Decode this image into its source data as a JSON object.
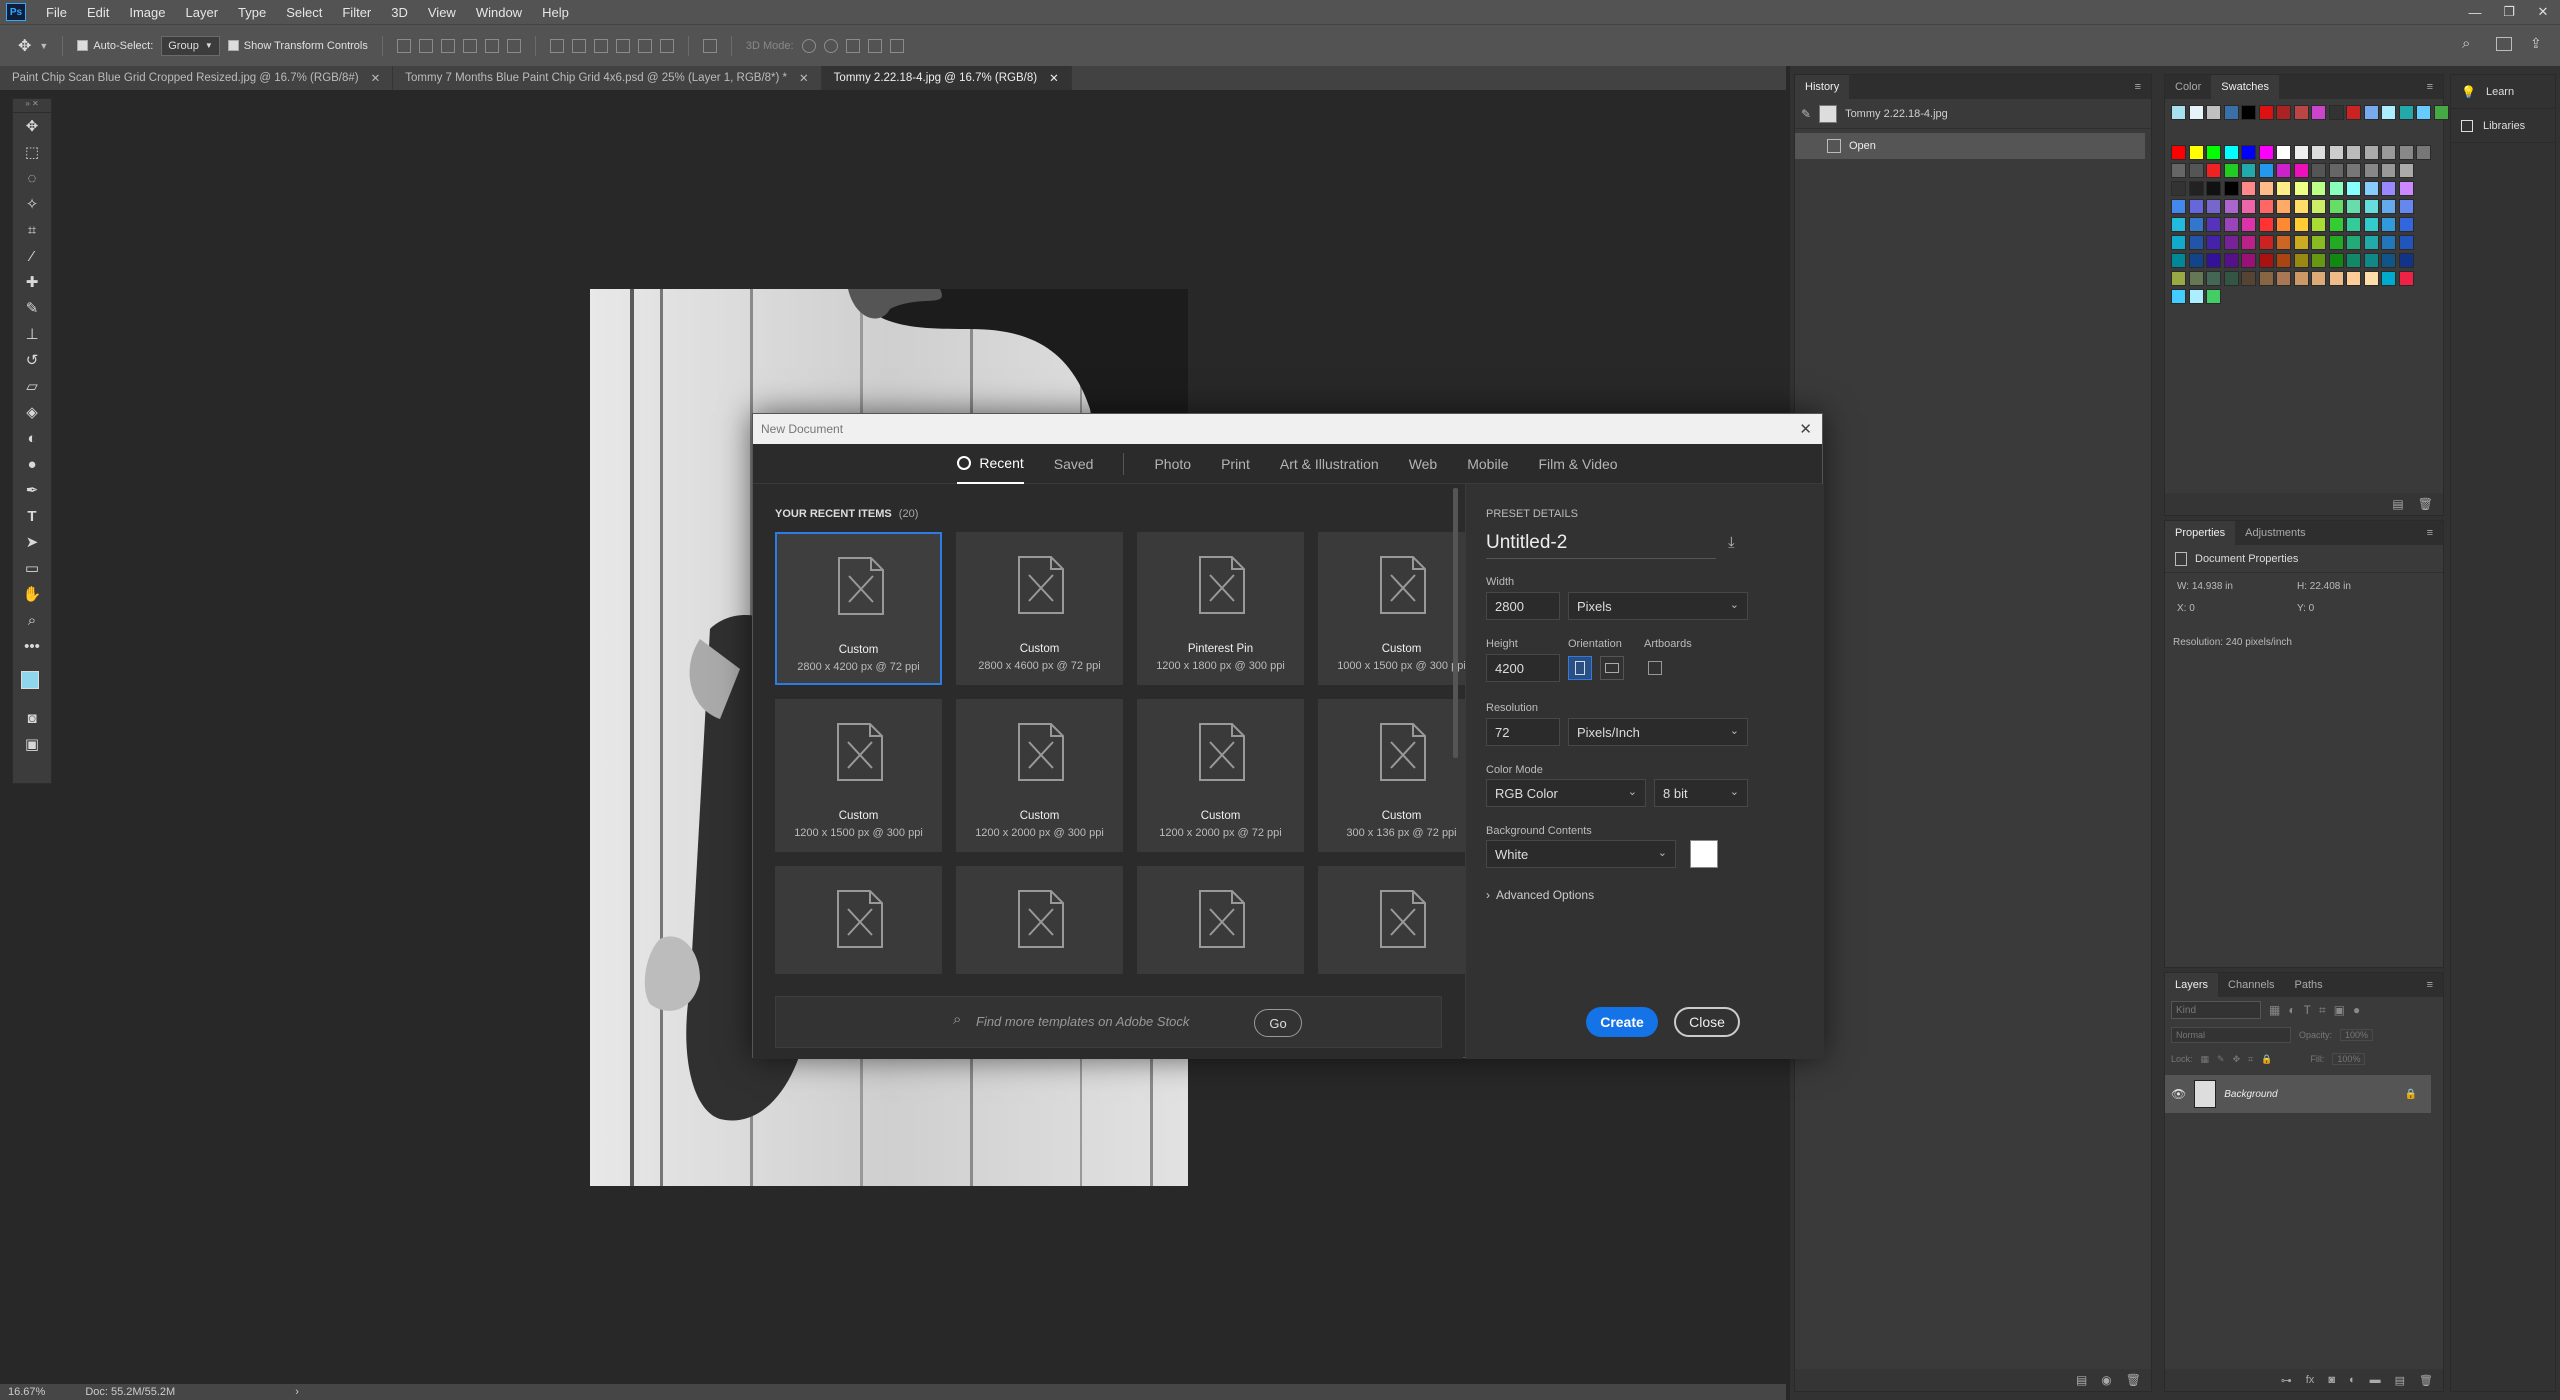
{
  "app": {
    "logo_text": "Ps"
  },
  "menu": [
    "File",
    "Edit",
    "Image",
    "Layer",
    "Type",
    "Select",
    "Filter",
    "3D",
    "View",
    "Window",
    "Help"
  ],
  "window_controls": [
    "—",
    "❐",
    "✕"
  ],
  "options_bar": {
    "auto_select_label": "Auto-Select:",
    "auto_select_value": "Group",
    "show_transform_label": "Show Transform Controls",
    "mode_3d_label": "3D Mode:"
  },
  "doc_tabs": [
    {
      "title": "Paint Chip Scan Blue Grid Cropped Resized.jpg @ 16.7% (RGB/8#)",
      "active": false
    },
    {
      "title": "Tommy 7 Months Blue Paint Chip Grid 4x6.psd @ 25% (Layer 1, RGB/8*) *",
      "active": false
    },
    {
      "title": "Tommy 2.22.18-4.jpg @ 16.7% (RGB/8)",
      "active": true
    }
  ],
  "status": {
    "zoom": "16.67%",
    "doc": "Doc: 55.2M/55.2M"
  },
  "history": {
    "tab": "History",
    "snapshot": "Tommy 2.22.18-4.jpg",
    "items": [
      "Open"
    ]
  },
  "color_panel": {
    "tabs": [
      "Color",
      "Swatches"
    ],
    "active": "Swatches"
  },
  "learn_panel": {
    "learn": "Learn",
    "libraries": "Libraries"
  },
  "properties": {
    "tabs": [
      "Properties",
      "Adjustments"
    ],
    "section": "Document Properties",
    "w": "W:  14.938 in",
    "h": "H:  22.408 in",
    "x": "X:  0",
    "y": "Y:  0",
    "resolution": "Resolution:  240 pixels/inch"
  },
  "layers": {
    "tabs": [
      "Layers",
      "Channels",
      "Paths"
    ],
    "kind_placeholder": "Kind",
    "blend": "Normal",
    "opacity_label": "Opacity:",
    "opacity": "100%",
    "lock_label": "Lock:",
    "fill_label": "Fill:",
    "fill": "100%",
    "layer_name": "Background"
  },
  "dialog": {
    "title": "New Document",
    "tabs": [
      "Recent",
      "Saved",
      "Photo",
      "Print",
      "Art & Illustration",
      "Web",
      "Mobile",
      "Film & Video"
    ],
    "active_tab": "Recent",
    "recent_heading": "YOUR RECENT ITEMS",
    "recent_count": "(20)",
    "items": [
      {
        "name": "Custom",
        "size": "2800 x 4200 px @ 72 ppi",
        "selected": true
      },
      {
        "name": "Custom",
        "size": "2800 x 4600 px @ 72 ppi"
      },
      {
        "name": "Pinterest Pin",
        "size": "1200 x 1800 px @ 300 ppi"
      },
      {
        "name": "Custom",
        "size": "1000 x 1500 px @ 300 ppi"
      },
      {
        "name": "Custom",
        "size": "1200 x 1500 px @ 300 ppi"
      },
      {
        "name": "Custom",
        "size": "1200 x 2000 px @ 300 ppi"
      },
      {
        "name": "Custom",
        "size": "1200 x 2000 px @ 72 ppi"
      },
      {
        "name": "Custom",
        "size": "300 x 136 px @ 72 ppi"
      },
      {
        "name": "",
        "size": ""
      },
      {
        "name": "",
        "size": ""
      },
      {
        "name": "",
        "size": ""
      },
      {
        "name": "",
        "size": ""
      }
    ],
    "search_placeholder": "Find more templates on Adobe Stock",
    "go_label": "Go",
    "preset_heading": "PRESET DETAILS",
    "doc_name": "Untitled-2",
    "width_label": "Width",
    "width": "2800",
    "width_unit": "Pixels",
    "height_label": "Height",
    "height": "4200",
    "orientation_label": "Orientation",
    "artboards_label": "Artboards",
    "resolution_label": "Resolution",
    "resolution": "72",
    "resolution_unit": "Pixels/Inch",
    "color_mode_label": "Color Mode",
    "color_mode": "RGB Color",
    "bit_depth": "8 bit",
    "bg_label": "Background Contents",
    "bg_value": "White",
    "advanced_label": "Advanced Options",
    "create_label": "Create",
    "close_label": "Close"
  },
  "colors": {
    "accent": "#1473e6",
    "select_border": "#2d7be5"
  }
}
